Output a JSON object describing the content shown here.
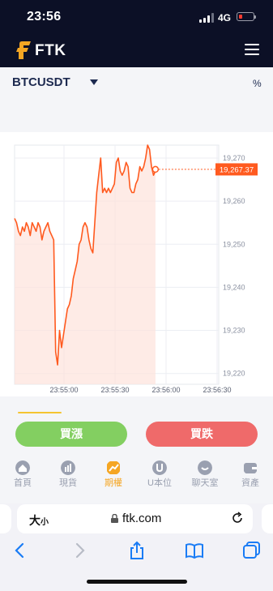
{
  "status_bar": {
    "time": "23:56",
    "network": "4G"
  },
  "app": {
    "brand": "FTK"
  },
  "symbol_bar": {
    "symbol": "BTCUSDT",
    "percent_label": "%"
  },
  "chart_data": {
    "type": "line",
    "title": "",
    "xlabel": "",
    "ylabel": "",
    "x_ticks": [
      "23:55:00",
      "23:55:30",
      "23:56:00",
      "23:56:30"
    ],
    "y_ticks": [
      "19,270",
      "19,260",
      "19,250",
      "19,240",
      "19,230",
      "19,220"
    ],
    "ylim": [
      19217.5,
      19273
    ],
    "current_price": 19267.37,
    "current_price_label": "19,267.37",
    "series": [
      {
        "x_seconds_after_23_54_30": [
          0,
          1,
          2,
          3,
          4,
          5,
          6,
          7,
          8,
          9,
          10,
          11,
          12,
          13,
          14,
          15,
          16,
          17,
          18,
          19,
          20,
          21,
          22,
          23,
          24,
          25,
          26,
          27,
          28,
          29,
          30,
          31,
          32,
          33,
          34,
          35,
          36,
          37,
          38,
          39,
          40,
          41,
          42,
          43,
          44,
          45,
          46,
          47,
          48,
          49,
          50,
          51,
          52,
          53,
          54,
          55,
          56,
          57,
          58,
          59,
          60,
          61,
          62,
          63,
          64,
          65,
          66,
          67,
          68,
          69,
          70,
          71,
          72,
          73,
          74,
          75,
          76,
          77,
          78,
          79,
          80,
          81,
          82,
          83,
          84
        ],
        "values": [
          19256,
          19255,
          19253,
          19252,
          19254,
          19253,
          19255,
          19254,
          19252,
          19255,
          19254,
          19253,
          19255,
          19254,
          19251,
          19253,
          19254,
          19255,
          19253,
          19252,
          19251,
          19225,
          19222,
          19230,
          19226,
          19229,
          19232,
          19235,
          19236,
          19238,
          19242,
          19244,
          19246,
          19250,
          19251,
          19254,
          19255,
          19254,
          19251,
          19249,
          19248,
          19255,
          19262,
          19266,
          19270,
          19262,
          19263,
          19262,
          19263,
          19262,
          19263,
          19264,
          19269,
          19270,
          19267,
          19266,
          19267,
          19269,
          19268,
          19263,
          19262,
          19262,
          19264,
          19265,
          19268,
          19267,
          19268,
          19270,
          19273,
          19272,
          19268,
          19266,
          19267
        ]
      }
    ]
  },
  "trade": {
    "buy_label": "買漲",
    "sell_label": "買跌"
  },
  "nav": {
    "items": [
      {
        "label": "首頁"
      },
      {
        "label": "現貨"
      },
      {
        "label": "期權"
      },
      {
        "label": "U本位"
      },
      {
        "label": "聊天室"
      },
      {
        "label": "資產"
      }
    ]
  },
  "browser": {
    "text_size_label": "大",
    "text_size_small": "小",
    "url": "ftk.com"
  },
  "colors": {
    "line": "#ff5a1f",
    "fill": "#fde3dc",
    "buy": "#83cf61",
    "sell": "#ef6a6a",
    "accent": "#f5a623"
  }
}
